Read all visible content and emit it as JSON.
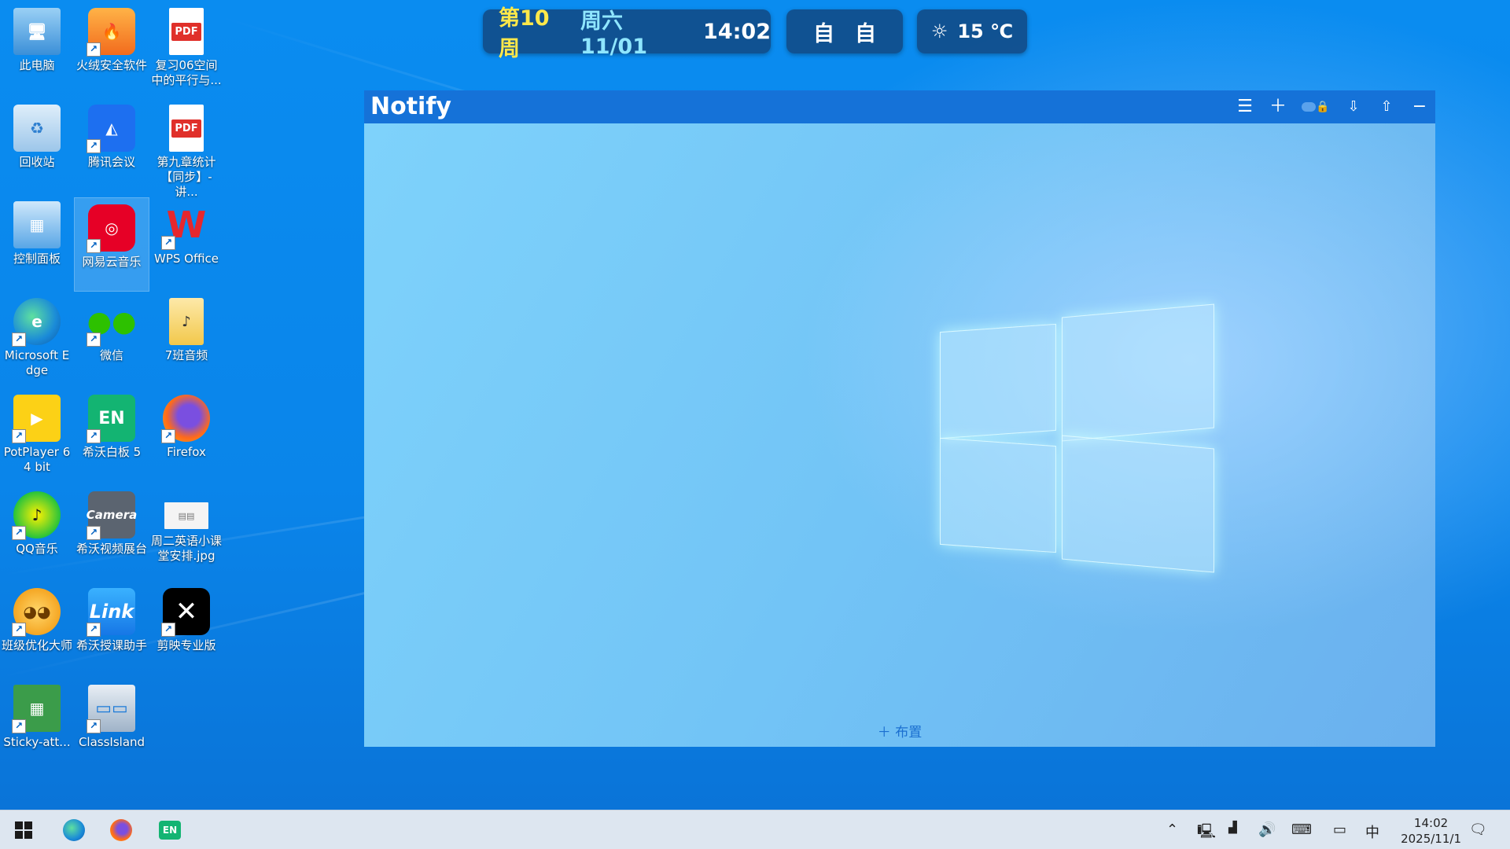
{
  "widgets": {
    "week": "第10周",
    "date": "周六 11/01",
    "time": "14:02",
    "subject_1": "自",
    "subject_2": "自",
    "weather": "15 ℃"
  },
  "desktop_icons": [
    {
      "label": "此电脑",
      "icon": "computer-icon"
    },
    {
      "label": "火绒安全软件",
      "icon": "huorong-icon"
    },
    {
      "label": "复习06空间中的平行与...",
      "icon": "pdf-icon"
    },
    {
      "label": "回收站",
      "icon": "recycle-bin-icon"
    },
    {
      "label": "腾讯会议",
      "icon": "tencent-meeting-icon"
    },
    {
      "label": "第九章统计【同步】-讲...",
      "icon": "pdf-icon"
    },
    {
      "label": "控制面板",
      "icon": "control-panel-icon"
    },
    {
      "label": "网易云音乐",
      "icon": "netease-music-icon"
    },
    {
      "label": "WPS Office",
      "icon": "wps-icon"
    },
    {
      "label": "Microsoft Edge",
      "icon": "edge-icon"
    },
    {
      "label": "微信",
      "icon": "wechat-icon"
    },
    {
      "label": "7班音频",
      "icon": "folder-icon"
    },
    {
      "label": "PotPlayer 64 bit",
      "icon": "potplayer-icon"
    },
    {
      "label": "希沃白板 5",
      "icon": "seewo-whiteboard-icon"
    },
    {
      "label": "Firefox",
      "icon": "firefox-icon"
    },
    {
      "label": "QQ音乐",
      "icon": "qq-music-icon"
    },
    {
      "label": "希沃视频展台",
      "icon": "camera-icon"
    },
    {
      "label": "周二英语小课堂安排.jpg",
      "icon": "image-file-icon"
    },
    {
      "label": "班级优化大师",
      "icon": "class-master-icon"
    },
    {
      "label": "希沃授课助手",
      "icon": "link-icon"
    },
    {
      "label": "剪映专业版",
      "icon": "capcut-icon"
    },
    {
      "label": "Sticky-att...",
      "icon": "sticky-icon"
    },
    {
      "label": "ClassIsland",
      "icon": "classisland-icon"
    }
  ],
  "notify": {
    "title": "Notify",
    "toolbar": [
      "menu-icon",
      "add-icon",
      "lock-toggle-icon",
      "import-icon",
      "export-icon",
      "minimize-icon"
    ],
    "add_layout_label": "＋ 布置"
  },
  "taskbar": {
    "apps": [
      "start-icon",
      "edge-icon",
      "firefox-icon",
      "seewo-whiteboard-icon"
    ],
    "tray": {
      "ime": "中"
    },
    "clock_time": "14:02",
    "clock_date": "2025/11/1"
  }
}
